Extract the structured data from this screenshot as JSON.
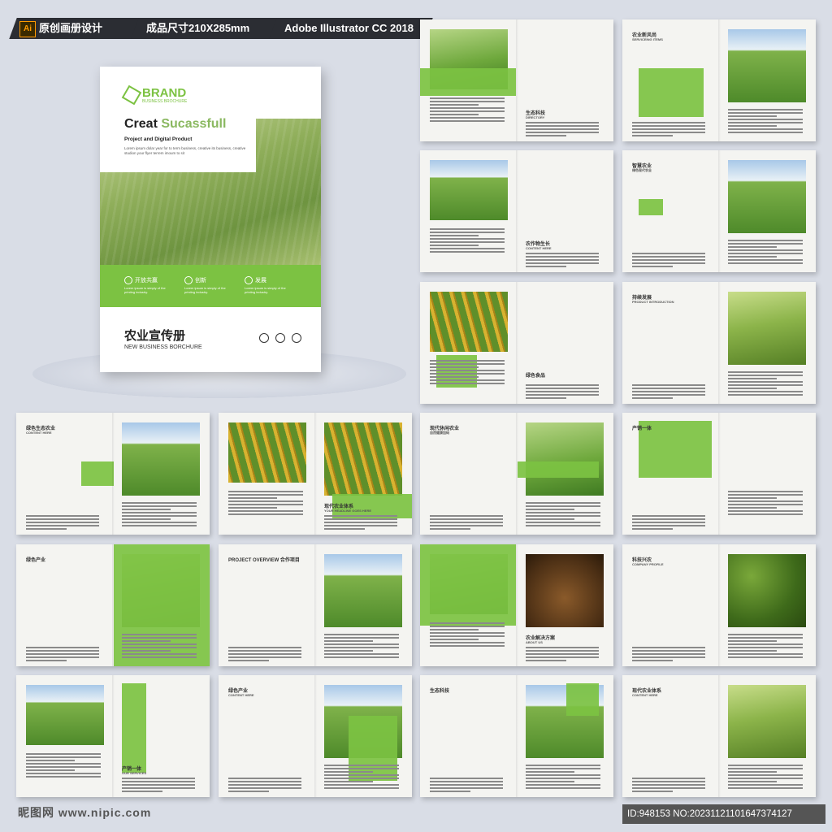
{
  "header": {
    "ai_badge": "Ai",
    "tag1": "原创画册设计",
    "tag2": "成品尺寸210X285mm",
    "tag3": "Adobe Illustrator CC 2018"
  },
  "cover": {
    "brand": "BRAND",
    "brand_sub": "BUSINESS BROCHURE",
    "headline_a": "Creat ",
    "headline_b": "Sucassfull",
    "subhead": "Project and Digital Product",
    "lorem": "Lorem ipsum dolar year for to term business, creative its business, creative studion your flyer terrem imoum to sit",
    "features": [
      {
        "label": "开放共赢",
        "text": "Lorem ipsum is simply of the printing industry."
      },
      {
        "label": "创新",
        "text": "Lorem ipsum is simply of the printing industry."
      },
      {
        "label": "发展",
        "text": "Lorem ipsum is simply of the printing industry."
      }
    ],
    "title_cn": "农业宣传册",
    "title_en": "NEW BUSINESS BORCHURE"
  },
  "spreads": [
    {
      "title": "生态科技",
      "sub": "DIRECTORY"
    },
    {
      "title": "农业新风尚",
      "sub": "SERVICEING ITEMS"
    },
    {
      "title": "农作物生长",
      "sub": "CONTENT HERE"
    },
    {
      "title": "智慧农业",
      "sub": "绿色现代农业"
    },
    {
      "title": "绿色食品",
      "sub": ""
    },
    {
      "title": "持续发展",
      "sub": "PRODUCT INTRODUCTION"
    },
    {
      "title": "绿色生态农业",
      "sub": "CONTENT HERE"
    },
    {
      "title": "现代农业体系",
      "sub": "YOUR HEADLINE GOES HERE"
    },
    {
      "title": "现代休闲农业",
      "sub": "自然健康加码"
    },
    {
      "title": "产销一体",
      "sub": ""
    },
    {
      "title": "绿色产业",
      "sub": ""
    },
    {
      "title": "PROJECT OVERVIEW 合作项目",
      "sub": ""
    },
    {
      "title": "农业解决方案",
      "sub": "ABOUT US"
    },
    {
      "title": "科技兴农",
      "sub": "COMPANY PROFILE"
    },
    {
      "title": "产销一体",
      "sub": "OUR SERVICES"
    },
    {
      "title": "绿色产业",
      "sub": "CONTENT HERE"
    },
    {
      "title": "生态科技",
      "sub": ""
    },
    {
      "title": "现代农业体系",
      "sub": "CONTENT HERE"
    }
  ],
  "footer": {
    "site": "昵图网 www.nipic.com",
    "id": "ID:948153 NO:20231121101647374127"
  },
  "colors": {
    "accent": "#7cc242",
    "dark": "#2b2d33"
  }
}
